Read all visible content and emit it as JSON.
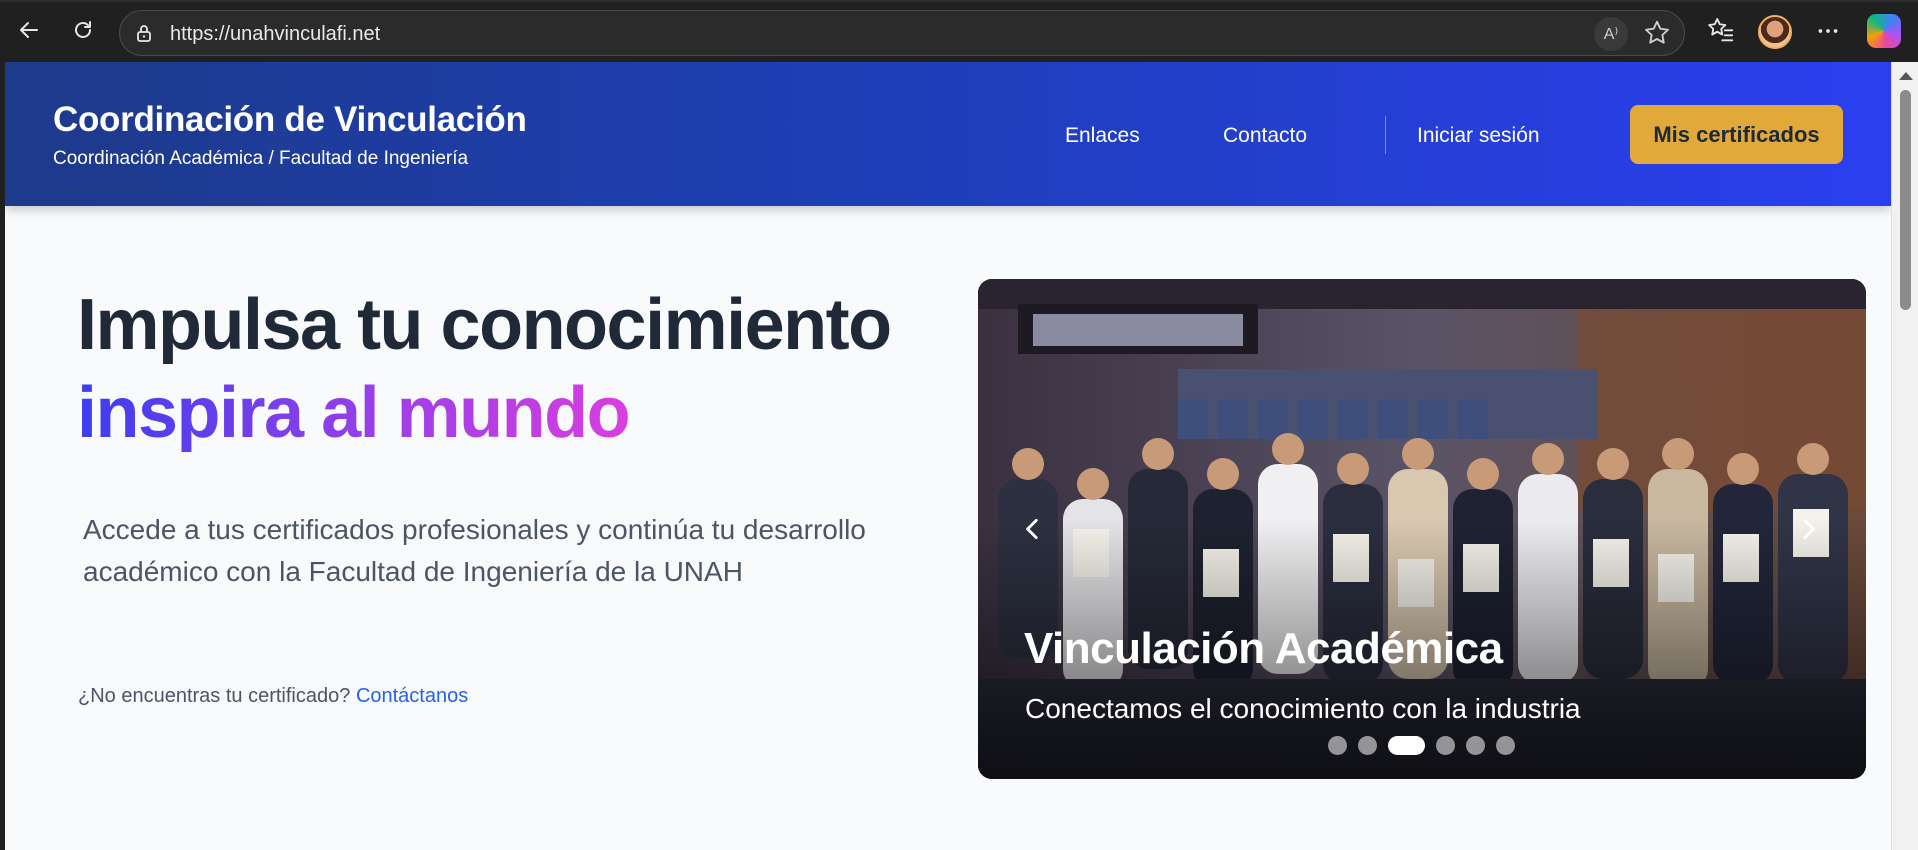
{
  "browser": {
    "url": "https://unahvinculafi.net",
    "read_aloud_label": "A⁾"
  },
  "header": {
    "title": "Coordinación de Vinculación",
    "subtitle": "Coordinación Académica / Facultad de Ingeniería",
    "nav": {
      "links_label": "Enlaces",
      "contact_label": "Contacto",
      "login_label": "Iniciar sesión"
    },
    "cta_label": "Mis certificados"
  },
  "hero": {
    "line1": "Impulsa tu conocimiento",
    "line2": "inspira al mundo",
    "description": "Accede a tus certificados profesionales y continúa tu desarrollo académico con la Facultad de Ingeniería de la UNAH",
    "help_text": "¿No encuentras tu certificado?",
    "help_link": "Contáctanos"
  },
  "carousel": {
    "slide_title": "Vinculación Académica",
    "slide_subtitle": "Conectamos el conocimiento con la industria",
    "total_slides": 6,
    "active_slide": 3
  },
  "colors": {
    "header_start": "#1e3a8a",
    "header_end": "#2b3ff0",
    "cta": "#e0a93a",
    "gradient_text_start": "#3b3ef0",
    "gradient_text_end": "#d93ee0",
    "link": "#2563eb"
  },
  "icons": [
    "back-icon",
    "refresh-icon",
    "lock-icon",
    "read-aloud-icon",
    "favorite-star-icon",
    "favorites-list-icon",
    "profile-avatar",
    "more-icon",
    "copilot-icon",
    "chevron-left-icon",
    "chevron-right-icon"
  ]
}
